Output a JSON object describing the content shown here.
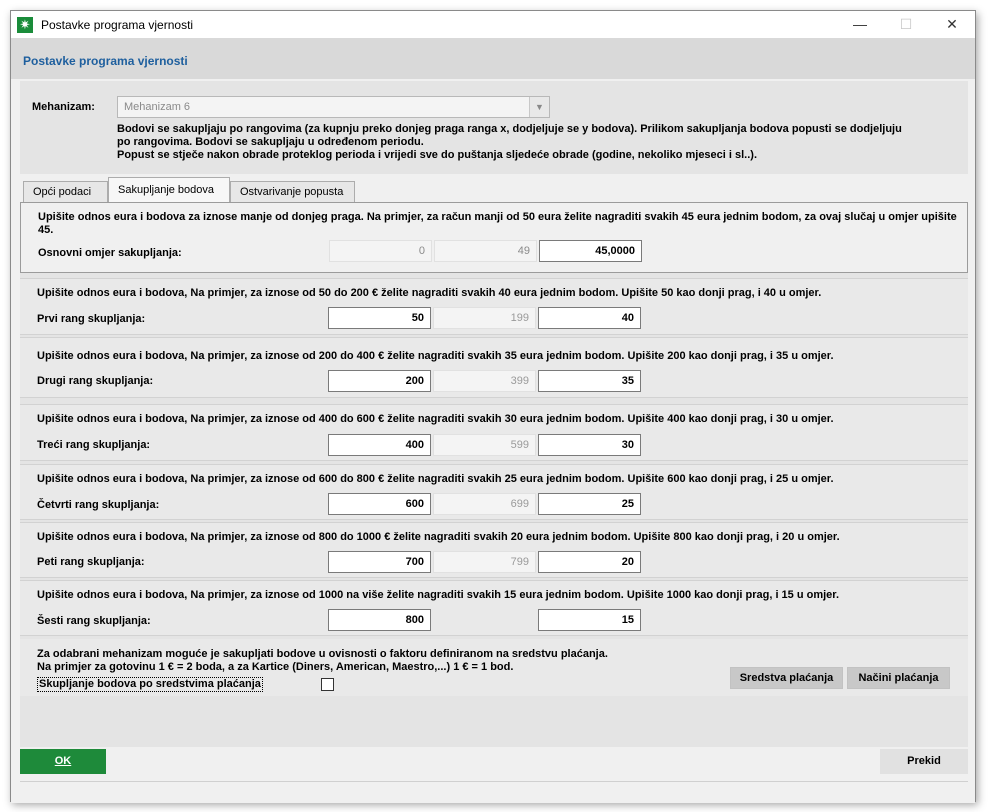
{
  "window": {
    "title": "Postavke programa vjernosti",
    "icon": "app-star-icon"
  },
  "header": {
    "title": "Postavke programa vjernosti"
  },
  "mechanism": {
    "label": "Mehanizam:",
    "value": "Mehanizam 6",
    "desc": [
      "Bodovi se sakupljaju po rangovima (za kupnju preko donjeg praga ranga x, dodjeljuje se y bodova). Prilikom sakupljanja bodova popusti se dodjeljuju",
      "po rangovima. Bodovi se sakupljaju u određenom periodu.",
      "Popust se stječe nakon obrade proteklog perioda i vrijedi sve do puštanja sljedeće obrade (godine, nekoliko mjeseci i sl..)."
    ]
  },
  "tabs": [
    {
      "label": "Opći podaci"
    },
    {
      "label": "Sakupljanje bodova"
    },
    {
      "label": "Ostvarivanje popusta"
    }
  ],
  "ranks": [
    {
      "desc": "Upišite odnos eura i bodova za iznose manje od donjeg praga. Na primjer, za račun manji od 50 eura želite nagraditi svakih 45 eura jednim bodom, za ovaj slučaj u omjer upišite 45.",
      "label": "Osnovni omjer sakupljanja:",
      "from": "0",
      "to": "49",
      "ratio": "45,0000"
    },
    {
      "desc": "Upišite odnos eura i bodova, Na primjer, za iznose od 50 do 200 € želite nagraditi svakih 40 eura jednim bodom. Upišite 50 kao donji prag, i 40 u omjer.",
      "label": "Prvi rang skupljanja:",
      "from": "50",
      "to": "199",
      "ratio": "40"
    },
    {
      "desc": "Upišite odnos eura i bodova, Na primjer, za iznose od 200 do 400 € želite nagraditi svakih 35 eura jednim bodom. Upišite 200 kao donji prag, i 35 u omjer.",
      "label": "Drugi rang skupljanja:",
      "from": "200",
      "to": "399",
      "ratio": "35"
    },
    {
      "desc": "Upišite odnos eura i bodova, Na primjer, za iznose od 400 do 600 € želite nagraditi svakih 30 eura jednim bodom. Upišite 400 kao donji prag, i 30 u omjer.",
      "label": "Treći rang skupljanja:",
      "from": "400",
      "to": "599",
      "ratio": "30"
    },
    {
      "desc": "Upišite odnos eura i bodova, Na primjer, za iznose od 600 do 800 € želite nagraditi svakih 25 eura jednim bodom. Upišite 600 kao donji prag, i 25 u omjer.",
      "label": "Četvrti rang skupljanja:",
      "from": "600",
      "to": "699",
      "ratio": "25"
    },
    {
      "desc": "Upišite odnos eura i bodova, Na primjer, za iznose od 800 do 1000 € želite nagraditi svakih 20 eura jednim bodom. Upišite 800 kao donji prag, i 20 u omjer.",
      "label": "Peti rang skupljanja:",
      "from": "700",
      "to": "799",
      "ratio": "20"
    },
    {
      "desc": "Upišite odnos eura i bodova, Na primjer, za iznose od 1000 na više želite nagraditi svakih 15 eura jednim bodom. Upišite 1000 kao donji prag, i 15 u omjer.",
      "label": "Šesti rang skupljanja:",
      "from": "800",
      "ratio": "15"
    }
  ],
  "payment": {
    "line1": "Za odabrani mehanizam moguće je sakupljati bodove u ovisnosti o faktoru definiranom na sredstvu plaćanja.",
    "line2": "Na primjer za gotovinu 1 € = 2 boda, a za Kartice (Diners, American, Maestro,...) 1 € = 1 bod.",
    "checkbox_label": "Skupljanje bodova po sredstvima plaćanja",
    "btn_means": "Sredstva plaćanja",
    "btn_methods": "Načini plaćanja"
  },
  "footer": {
    "ok": "OK",
    "cancel": "Prekid"
  }
}
